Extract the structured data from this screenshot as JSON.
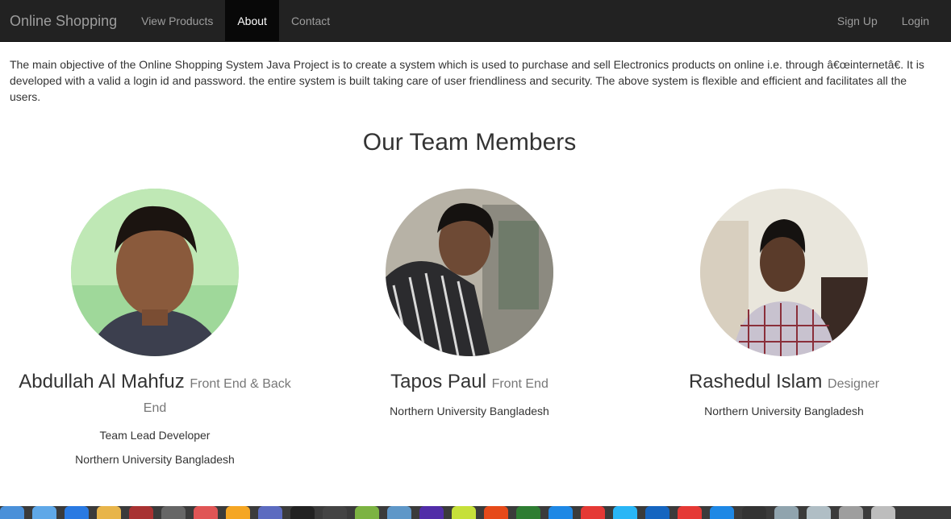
{
  "navbar": {
    "brand": "Online Shopping",
    "left_items": [
      {
        "label": "View Products",
        "active": false
      },
      {
        "label": "About",
        "active": true
      },
      {
        "label": "Contact",
        "active": false
      }
    ],
    "right_items": [
      {
        "label": "Sign Up"
      },
      {
        "label": "Login"
      }
    ]
  },
  "intro": {
    "text": "The main objective of the Online Shopping System Java Project is to create a system which is used to purchase and sell Electronics products on online i.e. through â€œinternetâ€. It is developed with a valid a login id and password. the entire system is built taking care of user friendliness and security. The above system is flexible and efficient and facilitates all the users."
  },
  "team": {
    "title": "Our Team Members",
    "members": [
      {
        "name": "Abdullah Al Mahfuz",
        "role": "Front End & Back End",
        "position": "Team Lead Developer",
        "university": "Northern University Bangladesh"
      },
      {
        "name": "Tapos Paul",
        "role": "Front End",
        "university": "Northern University Bangladesh"
      },
      {
        "name": "Rashedul Islam",
        "role": "Designer",
        "university": "Northern University Bangladesh"
      }
    ]
  },
  "taskbar": {
    "icon_colors": [
      "#4a90d9",
      "#5fa8e8",
      "#2a7ae2",
      "#e8b54a",
      "#a83232",
      "#666666",
      "#e05555",
      "#f5a623",
      "#5c6bc0",
      "#222222",
      "#444444",
      "#7cb342",
      "#5e97c8",
      "#512da8",
      "#c6e03a",
      "#e64a19",
      "#2e7d32",
      "#1e88e5",
      "#e53935",
      "#29b6f6",
      "#1565c0",
      "#e53935",
      "#1e88e5",
      "#333333",
      "#90a4ae",
      "#b0bec5",
      "#9e9e9e",
      "#bdbdbd"
    ]
  }
}
